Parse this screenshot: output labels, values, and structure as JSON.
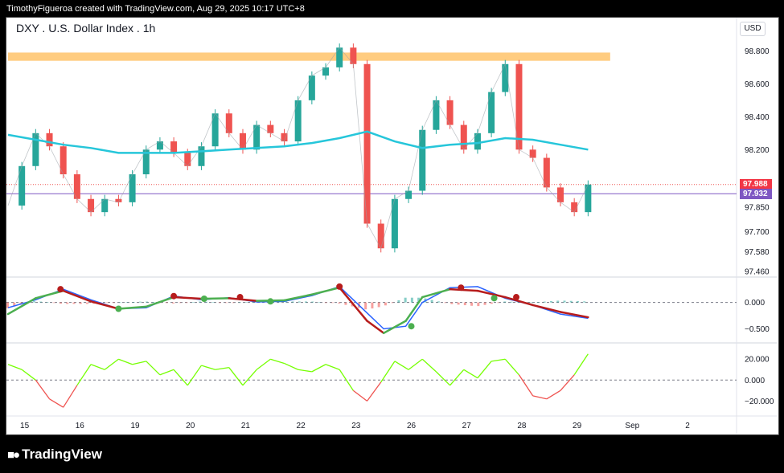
{
  "credit": "TimothyFigueroa created with TradingView.com, Aug 29, 2025 10:17 UTC+8",
  "symbol_title": "DXY . U.S. Dollar Index . 1h",
  "currency": "USD",
  "footer_brand": "TradingView",
  "colors": {
    "up": "#26a69a",
    "down": "#ef5350",
    "ma": "#26c6da",
    "zone": "#ffcc80",
    "signal_green": "#4caf50",
    "signal_red": "#b71c1c",
    "last_price_label": "#f23645",
    "hline_label": "#7e57c2",
    "rsi_up": "#76ff03",
    "rsi_down": "#ef5350",
    "macd_blue": "#2962ff"
  },
  "chart_data": [
    {
      "type": "line",
      "panel": "price",
      "title": "DXY . U.S. Dollar Index . 1h",
      "y_ticks": [
        98.8,
        98.6,
        98.4,
        98.2,
        97.85,
        97.7,
        97.58,
        97.46
      ],
      "y_tick_labels": [
        "98.800",
        "98.600",
        "98.400",
        "98.200",
        "97.850",
        "97.700",
        "97.580",
        "97.460"
      ],
      "ylim": [
        97.44,
        98.88
      ],
      "x_ticks": [
        "15",
        "16",
        "19",
        "20",
        "21",
        "22",
        "23",
        "26",
        "27",
        "28",
        "29",
        "Sep",
        "2"
      ],
      "series": [
        {
          "kind": "close",
          "x": [
            0.0,
            0.25,
            0.5,
            0.75,
            1.0,
            1.25,
            1.5,
            1.75,
            2.0,
            2.25,
            2.5,
            2.75,
            3.0,
            3.25,
            3.5,
            3.75,
            4.0,
            4.25,
            4.5,
            4.75,
            5.0,
            5.25,
            5.5,
            5.75,
            6.0,
            6.25,
            6.5,
            6.75,
            7.0,
            7.25,
            7.5,
            7.75,
            8.0,
            8.25,
            8.5,
            8.75,
            9.0,
            9.25,
            9.5,
            9.75,
            10.0,
            10.25,
            10.5
          ],
          "values": [
            97.86,
            98.1,
            98.3,
            98.22,
            98.05,
            97.9,
            97.82,
            97.9,
            97.88,
            98.05,
            98.2,
            98.25,
            98.18,
            98.1,
            98.22,
            98.42,
            98.3,
            98.2,
            98.35,
            98.3,
            98.25,
            98.5,
            98.65,
            98.7,
            98.82,
            98.72,
            97.75,
            97.6,
            97.9,
            97.95,
            98.32,
            98.5,
            98.35,
            98.2,
            98.3,
            98.55,
            98.72,
            98.2,
            98.15,
            97.97,
            97.88,
            97.82,
            97.988
          ]
        },
        {
          "kind": "moving_average",
          "x": [
            0.0,
            0.5,
            1.0,
            1.5,
            2.0,
            2.5,
            3.0,
            3.5,
            4.0,
            4.5,
            5.0,
            5.5,
            6.0,
            6.5,
            7.0,
            7.5,
            8.0,
            8.5,
            9.0,
            9.5,
            10.0,
            10.5
          ],
          "values": [
            98.29,
            98.26,
            98.23,
            98.21,
            98.18,
            98.18,
            98.18,
            98.19,
            98.2,
            98.21,
            98.22,
            98.24,
            98.27,
            98.31,
            98.25,
            98.21,
            98.23,
            98.24,
            98.27,
            98.26,
            98.23,
            98.2
          ]
        }
      ],
      "resistance_zone": [
        98.74,
        98.79
      ],
      "horizontal_line": 97.932,
      "last_price": 97.988,
      "price_labels": [
        "97.988",
        "97.932"
      ]
    },
    {
      "type": "line",
      "panel": "macd",
      "y_ticks": [
        0.0,
        -0.5
      ],
      "y_tick_labels": [
        "0.000",
        "−0.500"
      ],
      "ylim": [
        -0.72,
        0.45
      ],
      "series": [
        {
          "kind": "macd",
          "x": [
            0.0,
            0.5,
            1.0,
            1.5,
            2.0,
            2.5,
            3.0,
            3.5,
            4.0,
            4.5,
            5.0,
            5.5,
            6.0,
            6.5,
            6.8,
            7.2,
            7.5,
            8.0,
            8.5,
            9.0,
            9.5,
            10.0,
            10.5
          ],
          "values": [
            -0.22,
            0.08,
            0.22,
            0.02,
            -0.12,
            -0.08,
            0.1,
            0.07,
            0.08,
            0.03,
            0.04,
            0.15,
            0.28,
            -0.35,
            -0.58,
            -0.35,
            0.1,
            0.25,
            0.22,
            0.1,
            -0.05,
            -0.18,
            -0.28
          ]
        },
        {
          "kind": "signal",
          "x": [
            0.0,
            0.5,
            1.0,
            1.5,
            2.0,
            2.5,
            3.0,
            3.5,
            4.0,
            4.5,
            5.0,
            5.5,
            6.0,
            6.5,
            6.8,
            7.2,
            7.5,
            8.0,
            8.5,
            9.0,
            9.5,
            10.0,
            10.5
          ],
          "values": [
            -0.1,
            0.05,
            0.25,
            0.05,
            -0.12,
            -0.1,
            0.12,
            0.05,
            0.09,
            0.01,
            0.02,
            0.13,
            0.3,
            -0.2,
            -0.5,
            -0.45,
            0.0,
            0.28,
            0.3,
            0.08,
            -0.05,
            -0.22,
            -0.3
          ]
        }
      ],
      "cross_markers": [
        {
          "x": 0.95,
          "value": 0.25,
          "kind": "bearish"
        },
        {
          "x": 2.0,
          "value": -0.12,
          "kind": "bullish"
        },
        {
          "x": 3.0,
          "value": 0.12,
          "kind": "bearish"
        },
        {
          "x": 3.55,
          "value": 0.07,
          "kind": "bullish"
        },
        {
          "x": 4.2,
          "value": 0.1,
          "kind": "bearish"
        },
        {
          "x": 4.75,
          "value": 0.02,
          "kind": "bullish"
        },
        {
          "x": 6.0,
          "value": 0.3,
          "kind": "bearish"
        },
        {
          "x": 7.3,
          "value": -0.45,
          "kind": "bullish"
        },
        {
          "x": 8.2,
          "value": 0.28,
          "kind": "bearish"
        },
        {
          "x": 8.8,
          "value": 0.08,
          "kind": "bullish"
        },
        {
          "x": 9.2,
          "value": 0.1,
          "kind": "bearish"
        }
      ]
    },
    {
      "type": "line",
      "panel": "oscillator",
      "y_ticks": [
        20.0,
        0.0,
        -20.0
      ],
      "y_tick_labels": [
        "20.000",
        "0.000",
        "−20.000"
      ],
      "ylim": [
        -32,
        34
      ],
      "series": [
        {
          "kind": "oscillator",
          "x": [
            0.0,
            0.25,
            0.5,
            0.75,
            1.0,
            1.25,
            1.5,
            1.75,
            2.0,
            2.25,
            2.5,
            2.75,
            3.0,
            3.25,
            3.5,
            3.75,
            4.0,
            4.25,
            4.5,
            4.75,
            5.0,
            5.25,
            5.5,
            5.75,
            6.0,
            6.25,
            6.5,
            6.75,
            7.0,
            7.25,
            7.5,
            7.75,
            8.0,
            8.25,
            8.5,
            8.75,
            9.0,
            9.25,
            9.5,
            9.75,
            10.0,
            10.25,
            10.5
          ],
          "values": [
            15,
            10,
            0,
            -18,
            -26,
            -5,
            15,
            10,
            20,
            15,
            18,
            5,
            10,
            -5,
            14,
            10,
            12,
            -5,
            10,
            20,
            16,
            10,
            8,
            15,
            10,
            -10,
            -20,
            -2,
            18,
            10,
            20,
            8,
            -5,
            10,
            2,
            18,
            20,
            5,
            -15,
            -18,
            -10,
            5,
            25
          ]
        }
      ]
    }
  ]
}
